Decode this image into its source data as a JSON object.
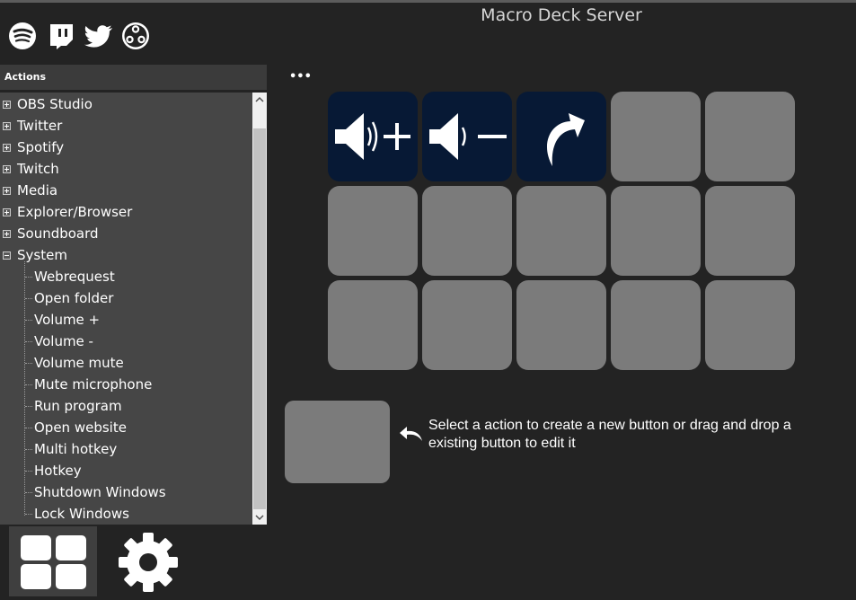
{
  "window": {
    "title": "Macro Deck Server"
  },
  "plugins": [
    {
      "icon": "spotify-icon"
    },
    {
      "icon": "twitch-icon"
    },
    {
      "icon": "twitter-icon"
    },
    {
      "icon": "obs-icon"
    }
  ],
  "actions_panel": {
    "header": "Actions",
    "tree": [
      {
        "label": "OBS Studio",
        "level": 0,
        "expander": "plus"
      },
      {
        "label": "Twitter",
        "level": 0,
        "expander": "plus"
      },
      {
        "label": "Spotify",
        "level": 0,
        "expander": "plus"
      },
      {
        "label": "Twitch",
        "level": 0,
        "expander": "plus"
      },
      {
        "label": "Media",
        "level": 0,
        "expander": "plus"
      },
      {
        "label": "Explorer/Browser",
        "level": 0,
        "expander": "plus"
      },
      {
        "label": "Soundboard",
        "level": 0,
        "expander": "plus"
      },
      {
        "label": "System",
        "level": 0,
        "expander": "minus"
      },
      {
        "label": "Webrequest",
        "level": 1
      },
      {
        "label": "Open folder",
        "level": 1
      },
      {
        "label": "Volume +",
        "level": 1
      },
      {
        "label": "Volume -",
        "level": 1
      },
      {
        "label": "Volume mute",
        "level": 1
      },
      {
        "label": "Mute microphone",
        "level": 1
      },
      {
        "label": "Run program",
        "level": 1
      },
      {
        "label": "Open website",
        "level": 1
      },
      {
        "label": "Multi hotkey",
        "level": 1
      },
      {
        "label": "Hotkey",
        "level": 1
      },
      {
        "label": "Shutdown Windows",
        "level": 1
      },
      {
        "label": "Lock Windows",
        "level": 1
      }
    ]
  },
  "nav": [
    {
      "icon": "deck-grid-icon",
      "active": true
    },
    {
      "icon": "gear-icon",
      "active": false
    }
  ],
  "deck": {
    "more_label": "•••",
    "rows": 3,
    "columns": 5,
    "buttons": [
      {
        "icon": "volume-up-icon"
      },
      {
        "icon": "volume-down-icon"
      },
      {
        "icon": "redo-arrow-icon"
      }
    ]
  },
  "editor": {
    "hint": "Select a action to create a new button or drag and drop a existing button to edit it"
  },
  "colors": {
    "background": "#232323",
    "panel": "#464646",
    "empty_slot": "#7b7b7b",
    "filled_slot": "#071935"
  }
}
